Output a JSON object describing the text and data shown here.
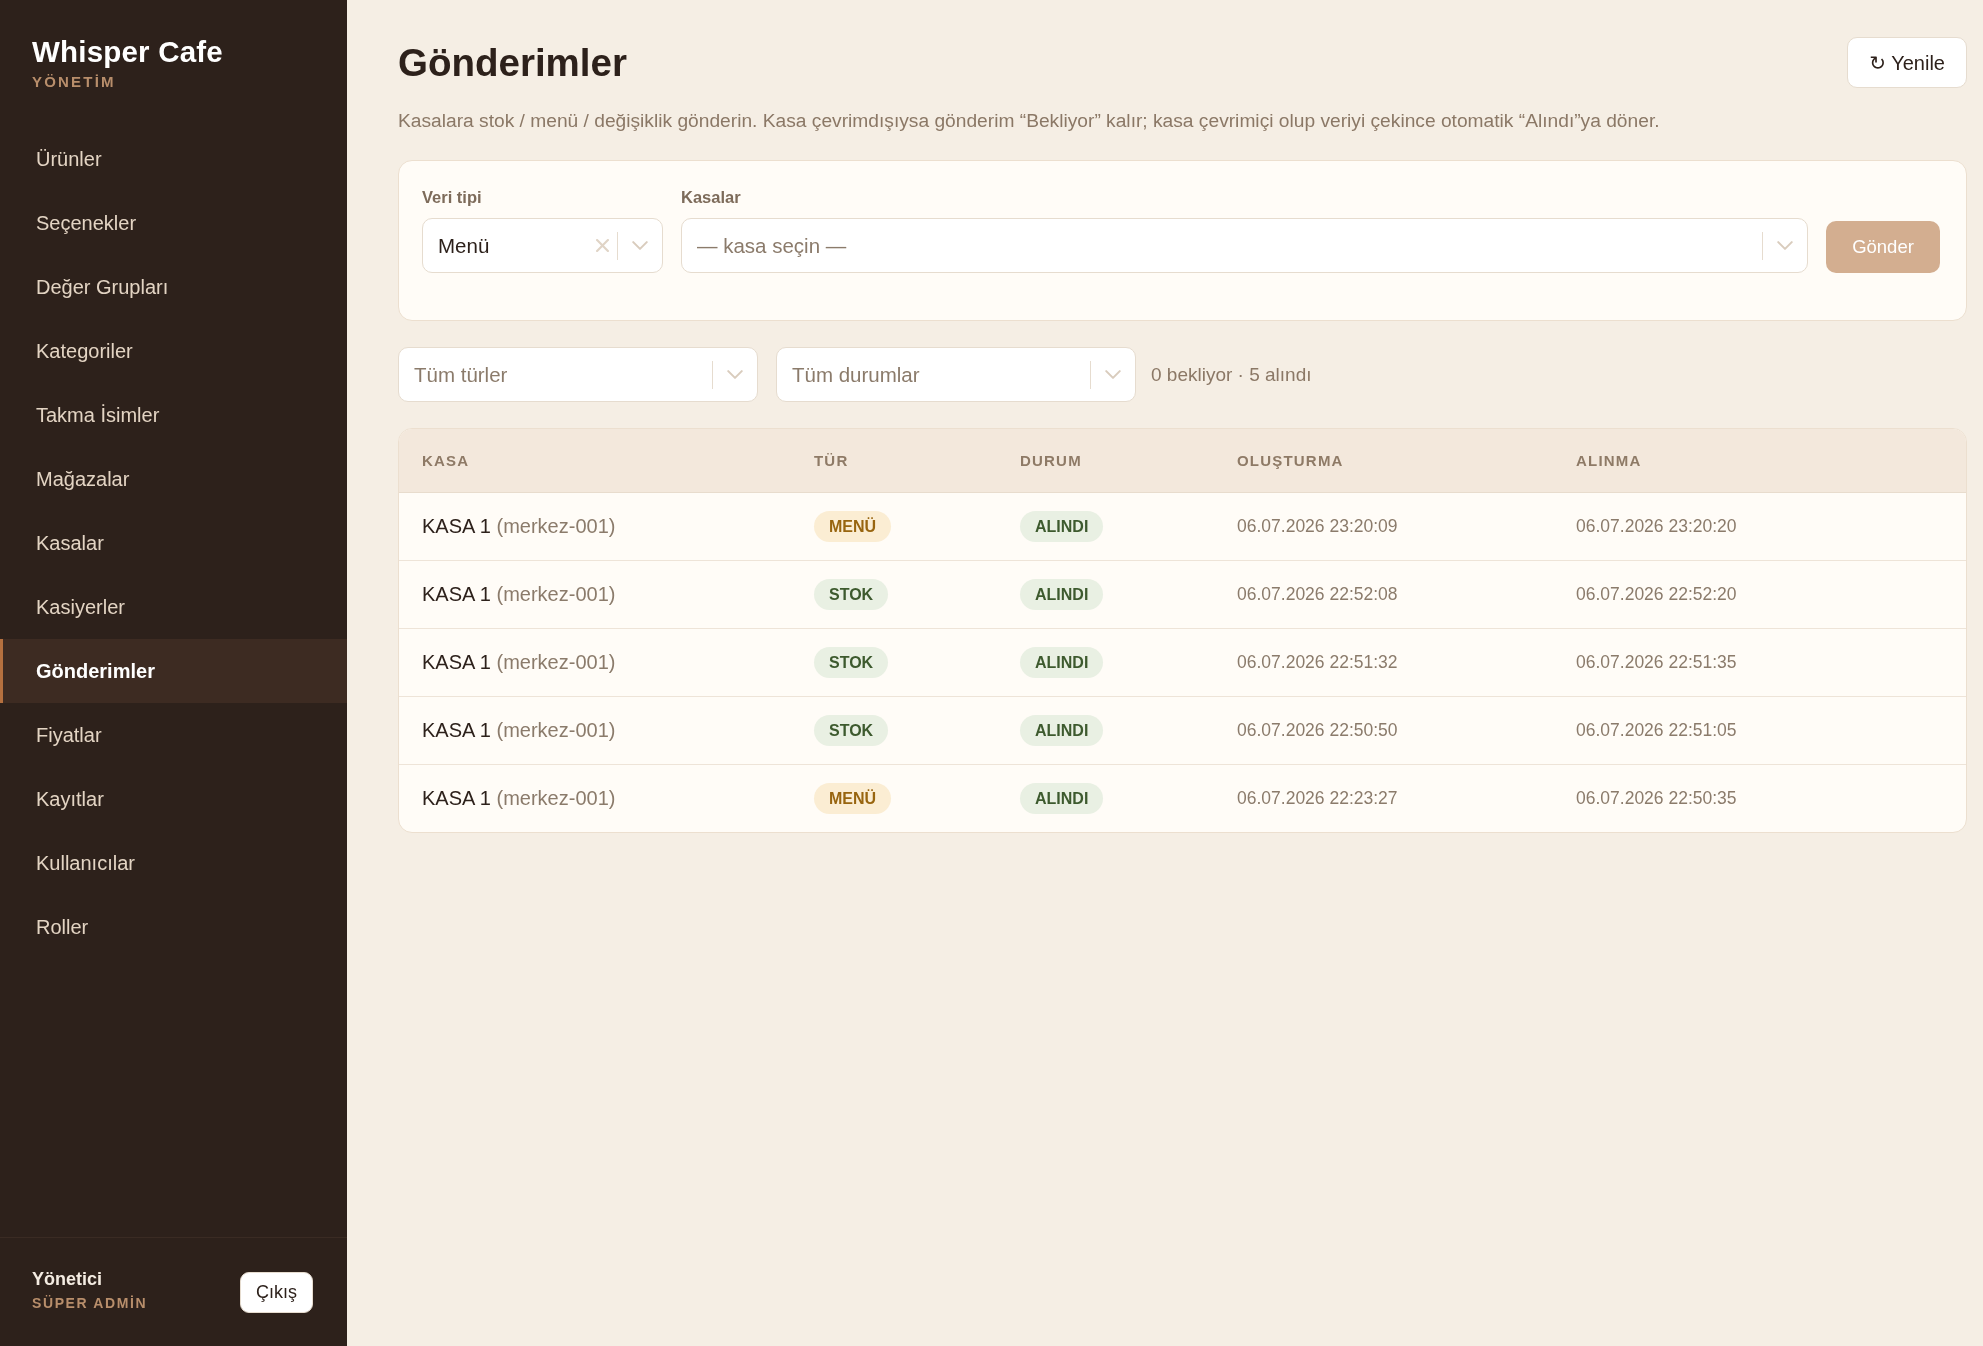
{
  "sidebar": {
    "brand": "Whisper Cafe",
    "subtitle": "YÖNETİM",
    "items": [
      {
        "label": "Ürünler",
        "selected": false
      },
      {
        "label": "Seçenekler",
        "selected": false
      },
      {
        "label": "Değer Grupları",
        "selected": false
      },
      {
        "label": "Kategoriler",
        "selected": false
      },
      {
        "label": "Takma İsimler",
        "selected": false
      },
      {
        "label": "Mağazalar",
        "selected": false
      },
      {
        "label": "Kasalar",
        "selected": false
      },
      {
        "label": "Kasiyerler",
        "selected": false
      },
      {
        "label": "Gönderimler",
        "selected": true
      },
      {
        "label": "Fiyatlar",
        "selected": false
      },
      {
        "label": "Kayıtlar",
        "selected": false
      },
      {
        "label": "Kullanıcılar",
        "selected": false
      },
      {
        "label": "Roller",
        "selected": false
      }
    ],
    "user": {
      "name": "Yönetici",
      "role": "SÜPER ADMİN"
    },
    "logout_button": "Çıkış"
  },
  "header": {
    "title": "Gönderimler",
    "refresh_button": "↻ Yenile",
    "description": "Kasalara stok / menü / değişiklik gönderin. Kasa çevrimdışıysa gönderim “Bekliyor” kalır; kasa çevrimiçi olup veriyi çekince otomatik “Alındı”ya döner."
  },
  "send_form": {
    "fields": [
      {
        "label": "Veri tipi",
        "value": "Menü",
        "clearable": true
      },
      {
        "label": "Kasalar",
        "placeholder": "— kasa seçin —",
        "clearable": false
      }
    ],
    "submit_button": {
      "label": "Gönder",
      "disabled": true
    }
  },
  "filters": {
    "selects": [
      {
        "placeholder": "Tüm türler"
      },
      {
        "placeholder": "Tüm durumlar"
      }
    ],
    "summary": "0 bekliyor · 5 alındı"
  },
  "table": {
    "columns": [
      "KASA",
      "TÜR",
      "DURUM",
      "OLUŞTURMA",
      "ALINMA"
    ],
    "rows": [
      {
        "register": "KASA 1",
        "code": "(merkez-001)",
        "type": {
          "label": "MENÜ",
          "kind": "menu"
        },
        "status": {
          "label": "ALINDI",
          "kind": "received"
        },
        "created": "06.07.2026 23:20:09",
        "received": "06.07.2026 23:20:20"
      },
      {
        "register": "KASA 1",
        "code": "(merkez-001)",
        "type": {
          "label": "STOK",
          "kind": "stock"
        },
        "status": {
          "label": "ALINDI",
          "kind": "received"
        },
        "created": "06.07.2026 22:52:08",
        "received": "06.07.2026 22:52:20"
      },
      {
        "register": "KASA 1",
        "code": "(merkez-001)",
        "type": {
          "label": "STOK",
          "kind": "stock"
        },
        "status": {
          "label": "ALINDI",
          "kind": "received"
        },
        "created": "06.07.2026 22:51:32",
        "received": "06.07.2026 22:51:35"
      },
      {
        "register": "KASA 1",
        "code": "(merkez-001)",
        "type": {
          "label": "STOK",
          "kind": "stock"
        },
        "status": {
          "label": "ALINDI",
          "kind": "received"
        },
        "created": "06.07.2026 22:50:50",
        "received": "06.07.2026 22:51:05"
      },
      {
        "register": "KASA 1",
        "code": "(merkez-001)",
        "type": {
          "label": "MENÜ",
          "kind": "menu"
        },
        "status": {
          "label": "ALINDI",
          "kind": "received"
        },
        "created": "06.07.2026 22:23:27",
        "received": "06.07.2026 22:50:35"
      }
    ]
  }
}
